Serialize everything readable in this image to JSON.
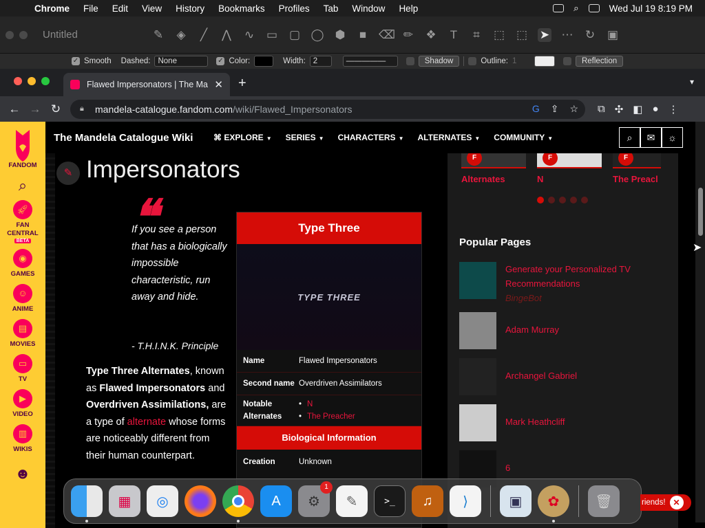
{
  "menubar": {
    "app_name": "Chrome",
    "items": [
      "File",
      "Edit",
      "View",
      "History",
      "Bookmarks",
      "Profiles",
      "Tab",
      "Window",
      "Help"
    ],
    "clock": "Wed Jul 19  8:19 PM"
  },
  "drawapp": {
    "title": "Untitled",
    "props": {
      "smooth_label": "Smooth",
      "dashed_label": "Dashed:",
      "dashed_value": "None",
      "color_label": "Color:",
      "width_label": "Width:",
      "width_value": "2",
      "shadow_label": "Shadow",
      "outline_label": "Outline:",
      "outline_value": "1",
      "reflection_label": "Reflection"
    }
  },
  "browser": {
    "tab_title": "Flawed Impersonators | The Ma",
    "url_host": "mandela-catalogue.fandom.com",
    "url_path": "/wiki/Flawed_Impersonators"
  },
  "rail": {
    "fandom_label": "FANDOM",
    "items": [
      {
        "label": "FAN CENTRAL",
        "badge": "BETA"
      },
      {
        "label": "GAMES"
      },
      {
        "label": "ANIME"
      },
      {
        "label": "MOVIES"
      },
      {
        "label": "TV"
      },
      {
        "label": "VIDEO"
      },
      {
        "label": "WIKIS"
      }
    ]
  },
  "wiki": {
    "name": "The Mandela Catalogue Wiki",
    "nav": [
      "EXPLORE",
      "SERIES",
      "CHARACTERS",
      "ALTERNATES",
      "COMMUNITY"
    ]
  },
  "article": {
    "title": "Impersonators",
    "quote": "If you see a person that has a biologically impossible characteristic, run away and hide.",
    "quote_source": "- T.H.I.N.K. Principle",
    "para_b1": "Type Three Alternates",
    "para_t1": ", known as ",
    "para_b2": "Flawed Impersonators",
    "para_t2": " and ",
    "para_b3": "Overdriven Assimilations,",
    "para_t3": " are a type of ",
    "para_link": "alternate",
    "para_t4": " whose forms are noticeably different from their human counterpart."
  },
  "infobox": {
    "title": "Type Three",
    "image_caption": "TYPE THREE",
    "rows": [
      {
        "key": "Name",
        "value": "Flawed Impersonators"
      },
      {
        "key": "Second name",
        "value": "Overdriven Assimilators"
      }
    ],
    "notable_key": "Notable Alternates",
    "notable": [
      "N",
      "The Preacher"
    ],
    "section": "Biological Information",
    "creation_key": "Creation",
    "creation_value": "Unknown"
  },
  "rightrail": {
    "carousel": [
      "Alternates",
      "N",
      "The Preacl"
    ],
    "popular_title": "Popular Pages",
    "popular": [
      {
        "title": "Generate your Personalized TV Recommendations",
        "sub": "BingeBot"
      },
      {
        "title": "Adam Murray"
      },
      {
        "title": "Archangel Gabriel"
      },
      {
        "title": "Mark Heathcliff"
      },
      {
        "title": "6"
      }
    ]
  },
  "toast": {
    "text": "riends!"
  },
  "colors": {
    "fandom_yellow": "#fecc33",
    "fandom_pink": "#fa005a",
    "wiki_red": "#d50c07",
    "link_red": "#e8153c"
  }
}
